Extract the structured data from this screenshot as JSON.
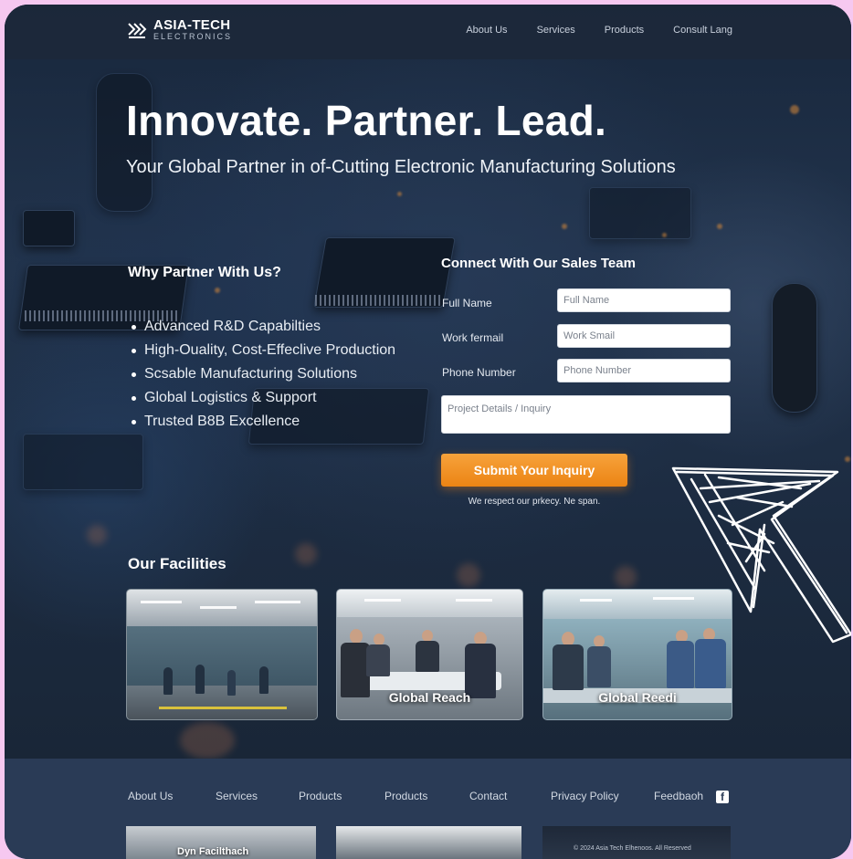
{
  "brand": {
    "name": "ASIA-TECH",
    "sub": "ELECTRONICS"
  },
  "nav": [
    "About Us",
    "Services",
    "Products",
    "Consult Lang"
  ],
  "hero": {
    "title": "Innovate. Partner. Lead.",
    "subtitle": "Your Global Partner in of-Cutting Electronic Manufacturing Solutions"
  },
  "why": {
    "title": "Why Partner With Us?",
    "items": [
      "Advanced R&D Capabilties",
      "High-Ouality, Cost-Effeclive Production",
      "Scsable Manufacturing Solutions",
      "Global Logistics & Support",
      "Trusted B8B Excellence"
    ]
  },
  "form": {
    "title": "Connect With Our Sales Team",
    "fields": [
      {
        "label": "Full Name",
        "placeholder": "Full Name"
      },
      {
        "label": "Work fermail",
        "placeholder": "Work Smail"
      },
      {
        "label": "Phone Number",
        "placeholder": "Phone Number"
      }
    ],
    "details_placeholder": "Project Details / Inquiry",
    "submit": "Submit Your Inquiry",
    "privacy": "We respect our prkecy. Ne span."
  },
  "facilities": {
    "title": "Our Facilities",
    "photos": [
      {
        "caption": ""
      },
      {
        "caption": "Global Reach"
      },
      {
        "caption": "Global Reedi"
      }
    ]
  },
  "footer": {
    "links": [
      "About Us",
      "Services",
      "Products",
      "Products",
      "Contact",
      "Privacy Policy",
      "Feedbaoh"
    ],
    "thumb_caption": "Dyn Facilthach",
    "copyright": "© 2024 Asia Tech Elhenoos. All Reserved"
  },
  "colors": {
    "accent": "#f39a2d",
    "background": "#1c2b40",
    "footer": "#2a3b56",
    "frame": "#f6c8f0"
  }
}
